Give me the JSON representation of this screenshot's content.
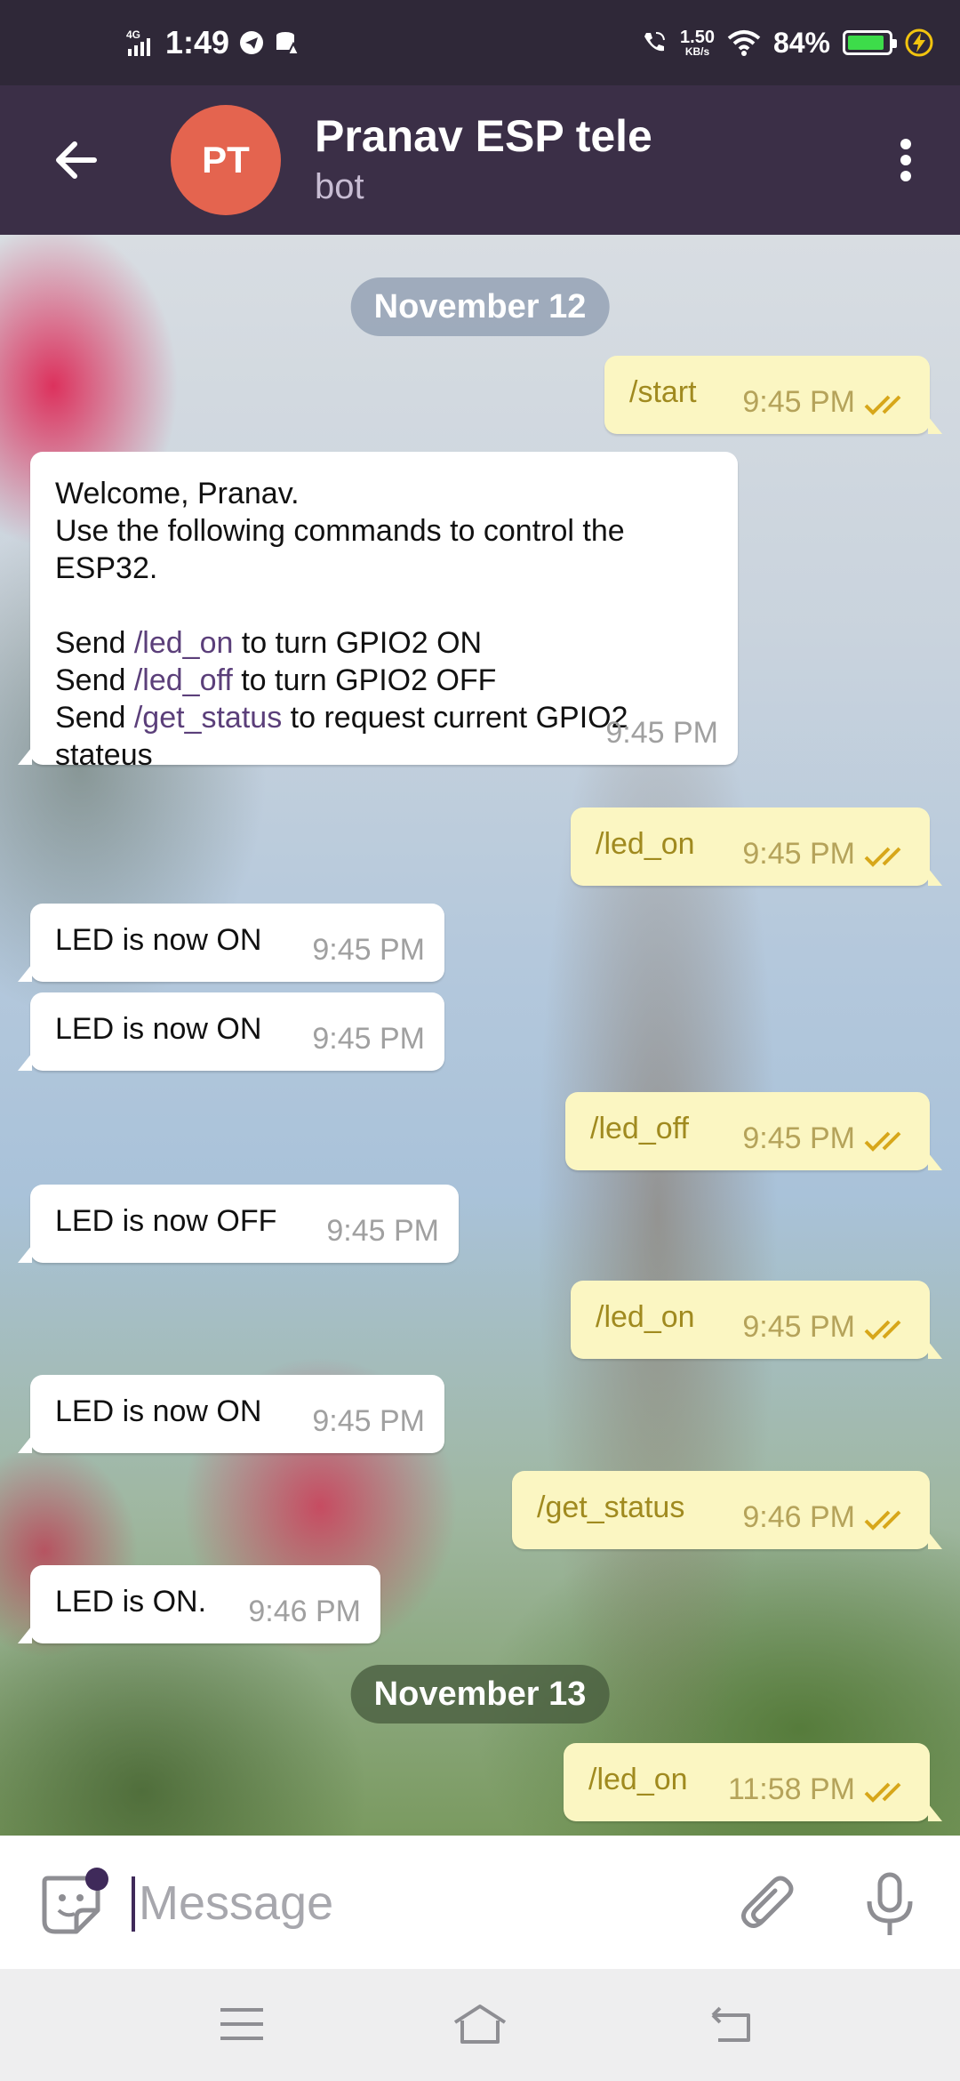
{
  "status_bar": {
    "network": "4G",
    "time": "1:49",
    "speed_value": "1.50",
    "speed_unit": "KB/s",
    "battery": "84%"
  },
  "header": {
    "avatar_initials": "PT",
    "title": "Pranav ESP tele",
    "subtitle": "bot"
  },
  "dates": [
    "November 12",
    "November 13"
  ],
  "messages": [
    {
      "dir": "out",
      "text": "/start",
      "time": "9:45 PM"
    },
    {
      "dir": "in",
      "type": "welcome",
      "line1": "Welcome, Pranav.",
      "line2": "Use the following commands to control the",
      "line3": "ESP32.",
      "send": "Send",
      "cmd_on": "/led_on",
      "on_rest": "to turn GPIO2 ON",
      "cmd_off": "/led_off",
      "off_rest": "to turn GPIO2 OFF",
      "cmd_status": "/get_status",
      "status_rest": "to request current GPIO2",
      "last": "stateus",
      "time": "9:45 PM"
    },
    {
      "dir": "out",
      "text": "/led_on",
      "time": "9:45 PM"
    },
    {
      "dir": "in",
      "text": "LED is now ON",
      "time": "9:45 PM"
    },
    {
      "dir": "in",
      "text": "LED is now ON",
      "time": "9:45 PM"
    },
    {
      "dir": "out",
      "text": "/led_off",
      "time": "9:45 PM"
    },
    {
      "dir": "in",
      "text": "LED is now OFF",
      "time": "9:45 PM"
    },
    {
      "dir": "out",
      "text": "/led_on",
      "time": "9:45 PM"
    },
    {
      "dir": "in",
      "text": "LED is now ON",
      "time": "9:45 PM"
    },
    {
      "dir": "out",
      "text": "/get_status",
      "time": "9:46 PM"
    },
    {
      "dir": "in",
      "text": "LED is ON.",
      "time": "9:46 PM"
    },
    {
      "dir": "out",
      "text": "/led_on",
      "time": "11:58 PM"
    }
  ],
  "input": {
    "placeholder": "Message"
  },
  "icons": [
    "back-arrow-icon",
    "more-vert-icon",
    "sticker-icon",
    "attach-icon",
    "mic-icon",
    "nav-menu-icon",
    "nav-home-icon",
    "nav-back-icon"
  ],
  "colors": {
    "header": "#3b2f47",
    "avatar": "#e4644f",
    "outgoing": "#fbf6c2",
    "incoming": "#ffffff",
    "command_link": "#5b3f7a"
  }
}
